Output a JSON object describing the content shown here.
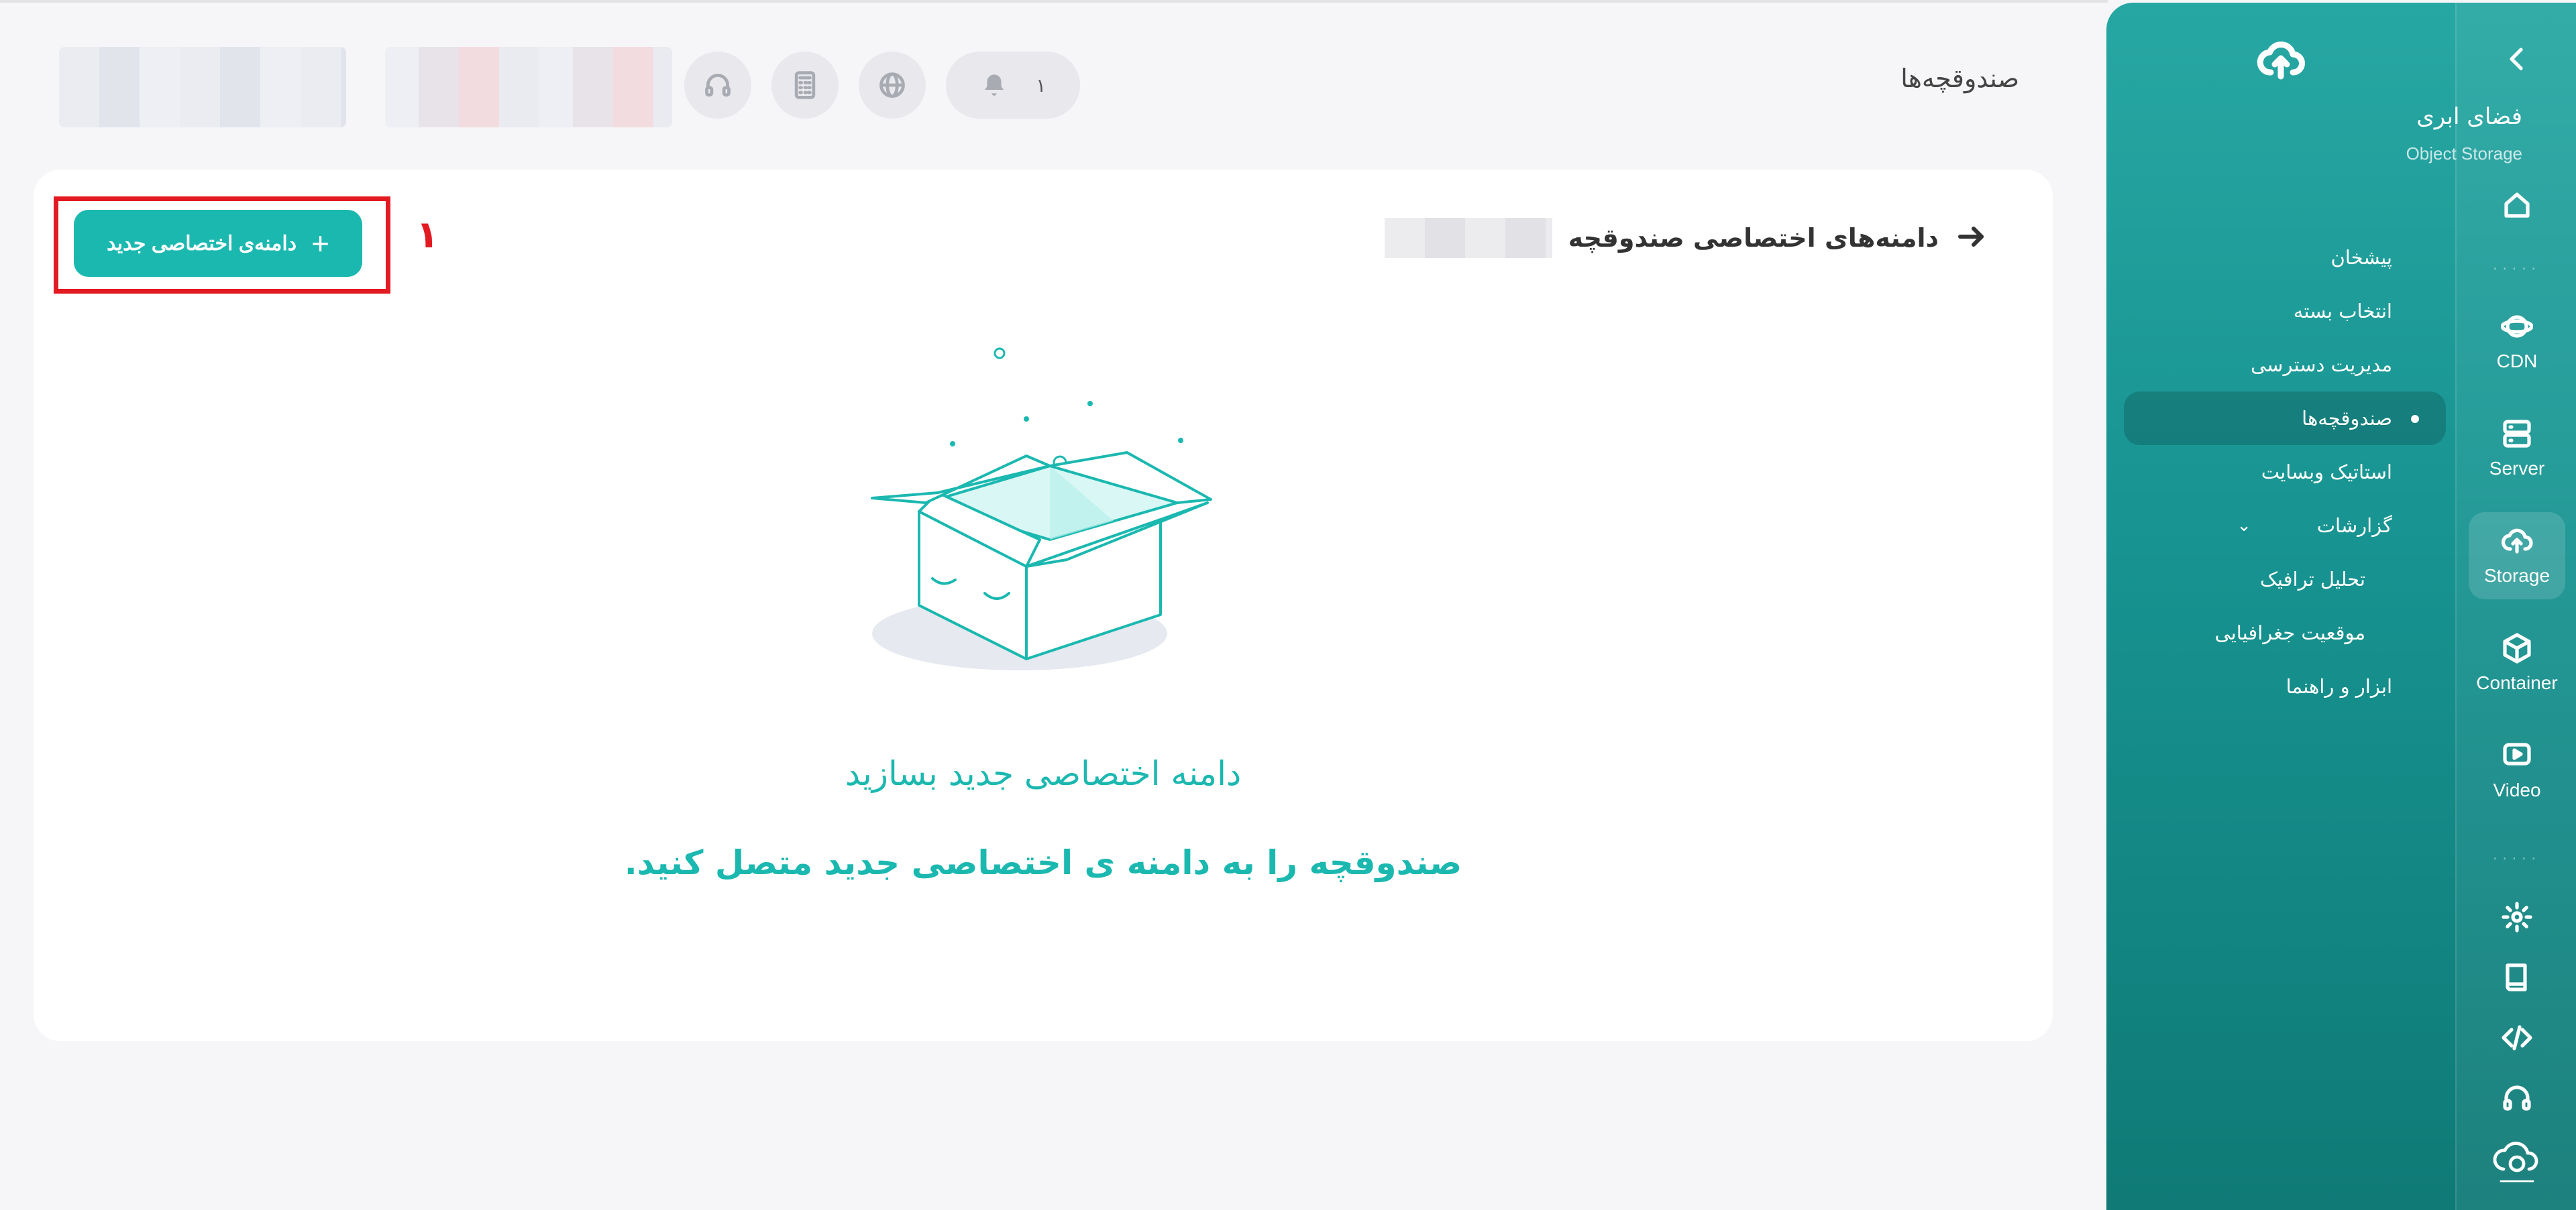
{
  "header": {
    "page_title": "صندوقچه‌ها",
    "notification_count": "۱"
  },
  "card": {
    "breadcrumb": "دامنه‌های اختصاصی صندوقچه",
    "new_domain_button": "دامنه‌ی اختصاصی جدید",
    "step_number": "۱",
    "empty_title": "دامنه اختصاصی جدید بسازید",
    "empty_subtitle": "صندوقچه را به دامنه ی اختصاصی جدید متصل کنید."
  },
  "sidebar": {
    "title": "فضای ابری",
    "subtitle": "Object Storage",
    "menu": [
      "پیشخان",
      "انتخاب بسته",
      "مدیریت دسترسی",
      "صندوقچه‌ها",
      "استاتیک وبسایت",
      "گزارشات",
      "تحلیل ترافیک",
      "موقعیت جغرافیایی",
      "ابزار و راهنما"
    ],
    "rail": {
      "cdn": "CDN",
      "server": "Server",
      "storage": "Storage",
      "container": "Container",
      "video": "Video"
    }
  },
  "colors": {
    "accent": "#1bb8b0",
    "sidebar_top": "#27a7a3",
    "sidebar_bottom": "#0f7a76",
    "highlight": "#e21a22"
  }
}
